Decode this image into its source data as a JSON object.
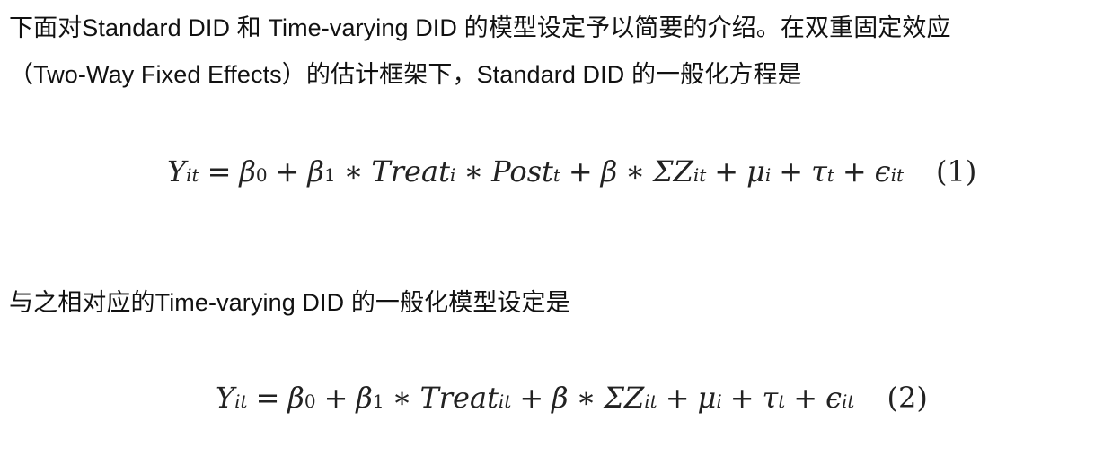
{
  "intro": {
    "line1": "下面对Standard DID 和 Time-varying DID 的模型设定予以简要的介绍。在双重固定效应",
    "line2": "（Two-Way Fixed Effects）的估计框架下，Standard DID 的一般化方程是"
  },
  "equation1": {
    "Y": "Y",
    "Y_sub": "it",
    "eq": "=",
    "b0": "β",
    "b0_sub": "0",
    "plus1": "+",
    "b1": "β",
    "b1_sub": "1",
    "mul1": "∗",
    "treat": "Treat",
    "treat_sub": "i",
    "mul2": "∗",
    "post": "Post",
    "post_sub": "t",
    "plus2": "+",
    "beta": "β",
    "mul3": "∗",
    "sigma": "ΣZ",
    "sigma_sub": "it",
    "plus3": "+",
    "mu": "μ",
    "mu_sub": "i",
    "plus4": "+",
    "tau": "τ",
    "tau_sub": "t",
    "plus5": "+",
    "eps": "ϵ",
    "eps_sub": "it",
    "tag": "(1)"
  },
  "bridge": {
    "line1": "与之相对应的Time-varying DID 的一般化模型设定是"
  },
  "equation2": {
    "Y": "Y",
    "Y_sub": "it",
    "eq": "=",
    "b0": "β",
    "b0_sub": "0",
    "plus1": "+",
    "b1": "β",
    "b1_sub": "1",
    "mul1": "∗",
    "treat": "Treat",
    "treat_sub": "it",
    "plus2": "+",
    "beta": "β",
    "mul3": "∗",
    "sigma": "ΣZ",
    "sigma_sub": "it",
    "plus3": "+",
    "mu": "μ",
    "mu_sub": "i",
    "plus4": "+",
    "tau": "τ",
    "tau_sub": "t",
    "plus5": "+",
    "eps": "ϵ",
    "eps_sub": "it",
    "tag": "(2)"
  }
}
